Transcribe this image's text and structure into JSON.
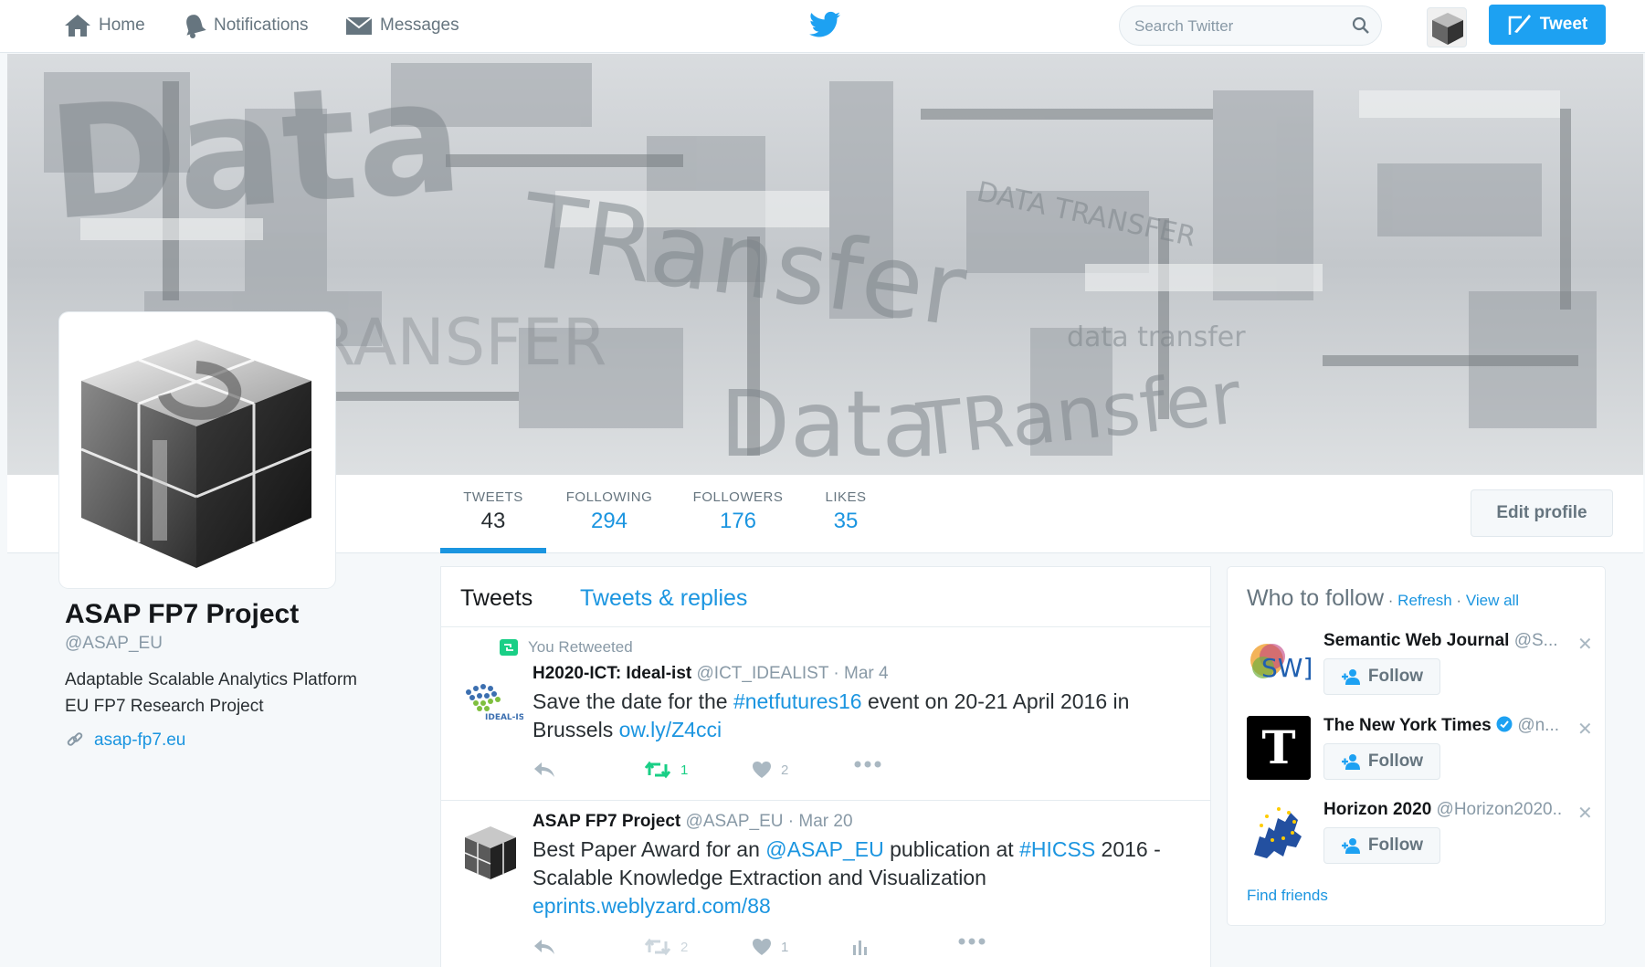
{
  "nav": {
    "home": "Home",
    "notifications": "Notifications",
    "messages": "Messages",
    "search_placeholder": "Search Twitter",
    "tweet_button": "Tweet"
  },
  "profile": {
    "name": "ASAP FP7 Project",
    "handle": "@ASAP_EU",
    "bio_line1": "Adaptable Scalable Analytics Platform",
    "bio_line2": "EU FP7 Research Project",
    "website": "asap-fp7.eu",
    "edit_button": "Edit profile"
  },
  "banner": {
    "words": [
      "Data",
      "TRansfer",
      "DATA TRANSFER",
      "data transfer",
      "TRANSFER",
      "Data",
      "TRansfer"
    ]
  },
  "stats": [
    {
      "label": "TWEETS",
      "value": "43"
    },
    {
      "label": "FOLLOWING",
      "value": "294"
    },
    {
      "label": "FOLLOWERS",
      "value": "176"
    },
    {
      "label": "LIKES",
      "value": "35"
    }
  ],
  "timeline": {
    "tabs": [
      "Tweets",
      "Tweets & replies"
    ],
    "tweets": [
      {
        "context": "You Retweeted",
        "name": "H2020-ICT: Ideal-ist",
        "handle": "@ICT_IDEALIST",
        "date": "· Mar 4",
        "avatar_text": "IDEAL-IST",
        "text_a": "Save the date for the ",
        "hashtag": "#netfutures16",
        "text_b": " event on 20-21 April 2016 in Brussels ",
        "link": "ow.ly/Z4cci",
        "retweets": "1",
        "likes": "2"
      },
      {
        "name": "ASAP FP7 Project",
        "handle": "@ASAP_EU",
        "date": "· Mar 20",
        "text_a": "Best Paper Award for an ",
        "mention": "@ASAP_EU",
        "text_b": " publication at ",
        "hashtag": "#HICSS",
        "text_c": " 2016 - Scalable Knowledge Extraction and Visualization",
        "link": "eprints.weblyzard.com/88",
        "retweets": "2",
        "likes": "1"
      }
    ]
  },
  "who_to_follow": {
    "title": "Who to follow",
    "sep1": " · ",
    "refresh": "Refresh",
    "sep2": " · ",
    "view_all": "View all",
    "follow_label": "Follow",
    "close": "✕",
    "find_friends": "Find friends",
    "items": [
      {
        "name": "Semantic Web Journal",
        "handle": "@S...",
        "avatar_text": "SW]"
      },
      {
        "name": "The New York Times",
        "handle": "@n...",
        "verified": true,
        "avatar_text": "T"
      },
      {
        "name": "Horizon 2020",
        "handle": "@Horizon2020..."
      }
    ]
  },
  "colors": {
    "accent": "#1da1f2",
    "link": "#1b95e0",
    "retweet_green": "#19cf86",
    "muted": "#8899a6"
  },
  "icons": [
    "home-icon",
    "bell-icon",
    "envelope-icon",
    "twitter-bird-icon",
    "search-icon",
    "compose-icon",
    "link-icon",
    "retweet-icon",
    "reply-icon",
    "heart-icon",
    "more-icon",
    "analytics-icon",
    "follow-person-icon",
    "verified-icon",
    "close-icon"
  ]
}
